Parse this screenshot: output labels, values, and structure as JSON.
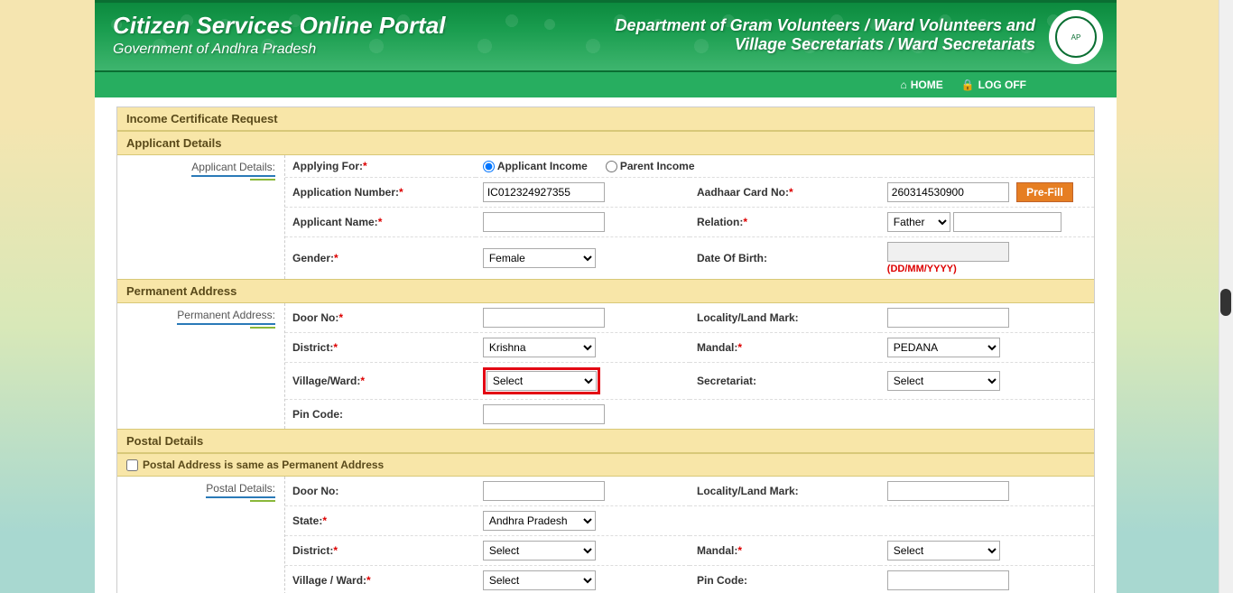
{
  "header": {
    "title": "Citizen Services Online Portal",
    "subtitle": "Government of Andhra Pradesh",
    "dept_line1": "Department of Gram Volunteers / Ward Volunteers and",
    "dept_line2": "Village Secretariats / Ward Secretariats"
  },
  "nav": {
    "home": "HOME",
    "logoff": "LOG OFF"
  },
  "form": {
    "title": "Income Certificate Request",
    "applicant": {
      "section_title": "Applicant Details",
      "side_label": "Applicant Details:",
      "applying_for_label": "Applying For:",
      "opt_applicant_income": "Applicant Income",
      "opt_parent_income": "Parent Income",
      "app_no_label": "Application Number:",
      "app_no_value": "IC012324927355",
      "aadhaar_label": "Aadhaar Card No:",
      "aadhaar_value": "260314530900",
      "prefill_btn": "Pre-Fill",
      "name_label": "Applicant Name:",
      "name_value": "",
      "relation_label": "Relation:",
      "relation_value": "Father",
      "relation_name_value": "",
      "gender_label": "Gender:",
      "gender_value": "Female",
      "dob_label": "Date Of Birth:",
      "dob_value": "",
      "dob_hint": "(DD/MM/YYYY)"
    },
    "perm_addr": {
      "section_title": "Permanent Address",
      "side_label": "Permanent Address:",
      "door_label": "Door No:",
      "door_value": "",
      "locality_label": "Locality/Land Mark:",
      "locality_value": "",
      "district_label": "District:",
      "district_value": "Krishna",
      "mandal_label": "Mandal:",
      "mandal_value": "PEDANA",
      "village_label": "Village/Ward:",
      "village_value": "Select",
      "secretariat_label": "Secretariat:",
      "secretariat_value": "Select",
      "pin_label": "Pin Code:",
      "pin_value": ""
    },
    "postal": {
      "section_title": "Postal Details",
      "same_as_label": "Postal Address is same as Permanent Address",
      "side_label": "Postal Details:",
      "door_label": "Door No:",
      "door_value": "",
      "locality_label": "Locality/Land Mark:",
      "locality_value": "",
      "state_label": "State:",
      "state_value": "Andhra Pradesh",
      "district_label": "District:",
      "district_value": "Select",
      "mandal_label": "Mandal:",
      "mandal_value": "Select",
      "village_label": "Village / Ward:",
      "village_value": "Select",
      "pin_label": "Pin Code:",
      "pin_value": ""
    }
  }
}
